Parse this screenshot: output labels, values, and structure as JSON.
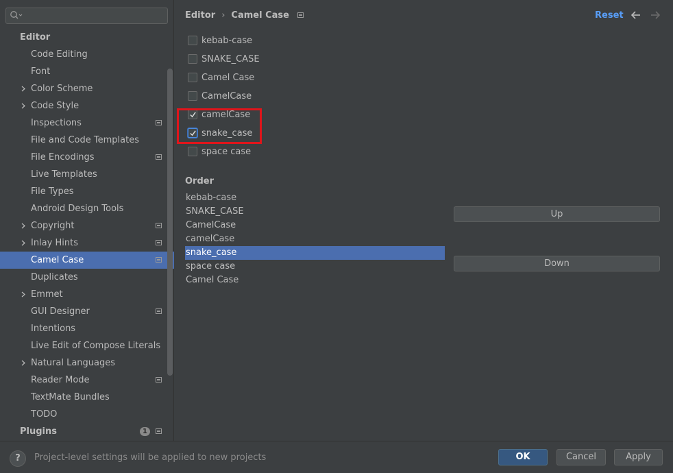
{
  "search": {
    "placeholder": ""
  },
  "tree": [
    {
      "label": "Editor",
      "type": "group"
    },
    {
      "label": "Code Editing",
      "type": "child"
    },
    {
      "label": "Font",
      "type": "child"
    },
    {
      "label": "Color Scheme",
      "type": "child",
      "expandable": true
    },
    {
      "label": "Code Style",
      "type": "child",
      "expandable": true
    },
    {
      "label": "Inspections",
      "type": "child",
      "badge": true
    },
    {
      "label": "File and Code Templates",
      "type": "child"
    },
    {
      "label": "File Encodings",
      "type": "child",
      "badge": true
    },
    {
      "label": "Live Templates",
      "type": "child"
    },
    {
      "label": "File Types",
      "type": "child"
    },
    {
      "label": "Android Design Tools",
      "type": "child"
    },
    {
      "label": "Copyright",
      "type": "child",
      "expandable": true,
      "badge": true
    },
    {
      "label": "Inlay Hints",
      "type": "child",
      "expandable": true,
      "badge": true
    },
    {
      "label": "Camel Case",
      "type": "child",
      "badge": true,
      "selected": true
    },
    {
      "label": "Duplicates",
      "type": "child"
    },
    {
      "label": "Emmet",
      "type": "child",
      "expandable": true
    },
    {
      "label": "GUI Designer",
      "type": "child",
      "badge": true
    },
    {
      "label": "Intentions",
      "type": "child"
    },
    {
      "label": "Live Edit of Compose Literals",
      "type": "child"
    },
    {
      "label": "Natural Languages",
      "type": "child",
      "expandable": true
    },
    {
      "label": "Reader Mode",
      "type": "child",
      "badge": true
    },
    {
      "label": "TextMate Bundles",
      "type": "child"
    },
    {
      "label": "TODO",
      "type": "child"
    },
    {
      "label": "Plugins",
      "type": "group",
      "count": "1",
      "badge": true
    }
  ],
  "breadcrumb": {
    "parent": "Editor",
    "separator": "›",
    "current": "Camel Case"
  },
  "header": {
    "reset_label": "Reset"
  },
  "checkboxes": [
    {
      "label": "kebab-case",
      "checked": false
    },
    {
      "label": "SNAKE_CASE",
      "checked": false
    },
    {
      "label": "Camel Case",
      "checked": false
    },
    {
      "label": "CamelCase",
      "checked": false
    },
    {
      "label": "camelCase",
      "checked": true
    },
    {
      "label": "snake_case",
      "checked": true,
      "focused": true
    },
    {
      "label": "space case",
      "checked": false
    }
  ],
  "order": {
    "title": "Order",
    "items": [
      "kebab-case",
      "SNAKE_CASE",
      "CamelCase",
      "camelCase",
      "snake_case",
      "space case",
      "Camel Case"
    ],
    "selected_index": 4,
    "up_label": "Up",
    "down_label": "Down"
  },
  "footer": {
    "help_label": "?",
    "note": "Project-level settings will be applied to new projects",
    "ok_label": "OK",
    "cancel_label": "Cancel",
    "apply_label": "Apply"
  },
  "colors": {
    "accent": "#4b6eaf",
    "link": "#589df6",
    "highlight_box": "#e0151b",
    "background": "#3c3f41"
  }
}
